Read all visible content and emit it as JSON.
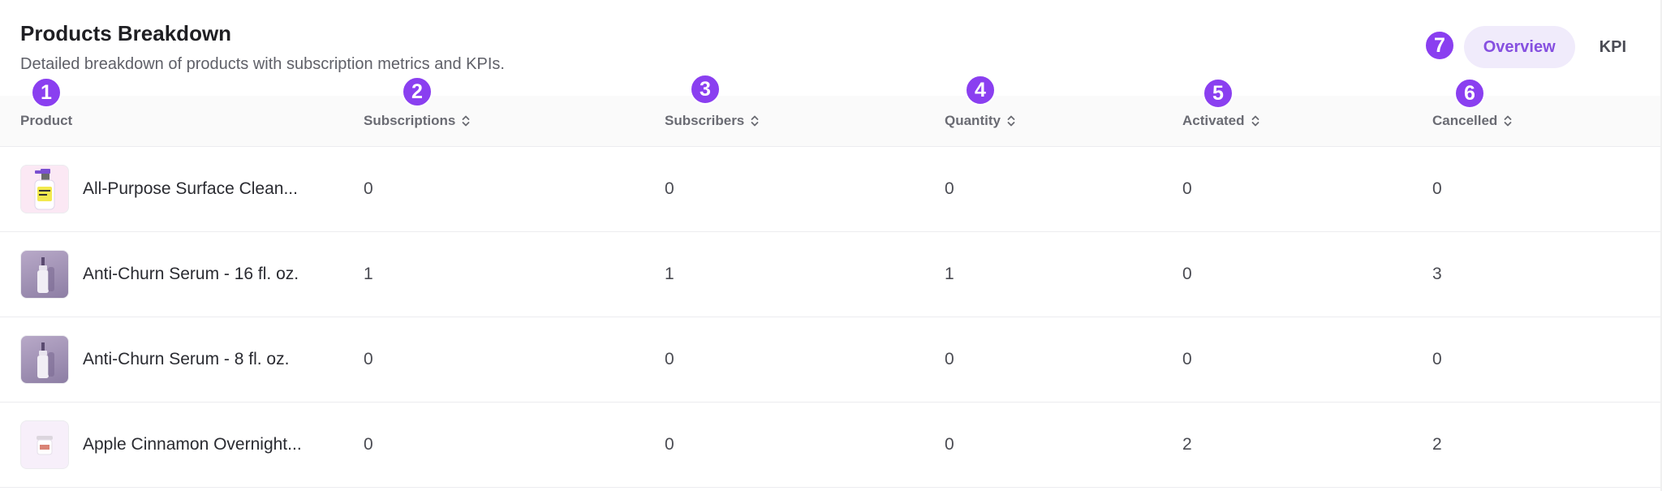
{
  "header": {
    "title": "Products Breakdown",
    "subtitle": "Detailed breakdown of products with subscription metrics and KPIs."
  },
  "view_toggle": {
    "options": [
      "Overview",
      "KPI"
    ],
    "selected": "Overview"
  },
  "table": {
    "columns": [
      "Product",
      "Subscriptions",
      "Subscribers",
      "Quantity",
      "Activated",
      "Cancelled"
    ],
    "sortable_columns": [
      "Subscriptions",
      "Subscribers",
      "Quantity",
      "Activated",
      "Cancelled"
    ],
    "rows": [
      {
        "product": "All-Purpose Surface Clean...",
        "subscriptions": "0",
        "subscribers": "0",
        "quantity": "0",
        "activated": "0",
        "cancelled": "0",
        "thumbnail": "spray-bottle-image"
      },
      {
        "product": "Anti-Churn Serum - 16 fl. oz.",
        "subscriptions": "1",
        "subscribers": "1",
        "quantity": "1",
        "activated": "0",
        "cancelled": "3",
        "thumbnail": "serum-bottle-image"
      },
      {
        "product": "Anti-Churn Serum - 8 fl. oz.",
        "subscriptions": "0",
        "subscribers": "0",
        "quantity": "0",
        "activated": "0",
        "cancelled": "0",
        "thumbnail": "serum-bottle-image"
      },
      {
        "product": "Apple Cinnamon Overnight...",
        "subscriptions": "0",
        "subscribers": "0",
        "quantity": "0",
        "activated": "2",
        "cancelled": "2",
        "thumbnail": "oats-jar-image"
      }
    ]
  },
  "annotations": {
    "markers": [
      "1",
      "2",
      "3",
      "4",
      "5",
      "6",
      "7"
    ],
    "color": "#8a3ff0"
  },
  "colors": {
    "accent": "#8650e0",
    "accent_bg": "#f0ebfb"
  }
}
